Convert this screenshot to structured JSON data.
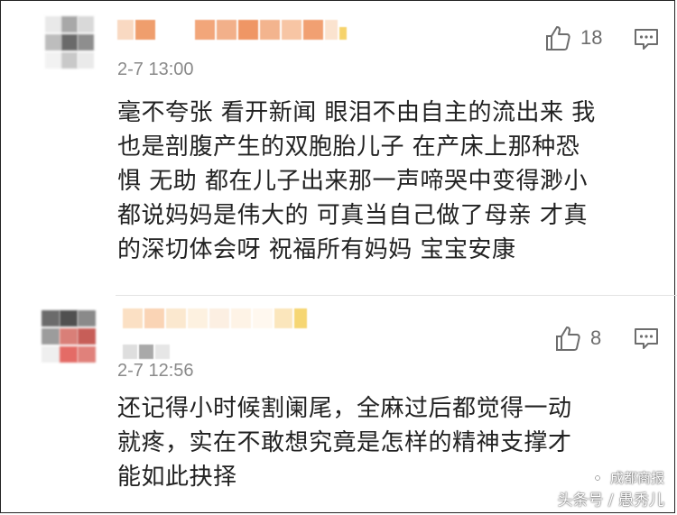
{
  "colors": {
    "text": "#222222",
    "meta": "#8a8a8a",
    "icon": "#6d6d6d",
    "divider": "#e3e3e3"
  },
  "comments": [
    {
      "time": "2-7 13:00",
      "likes": "18",
      "body_lines": [
        "毫不夸张 看开新闻 眼泪不由自主的流出来 我",
        "也是剖腹产生的双胞胎儿子 在产床上那种恐",
        "惧 无助 都在儿子出来那一声啼哭中变得渺小",
        "都说妈妈是伟大的 可真当自己做了母亲 才真",
        "的深切体会呀 祝福所有妈妈 宝宝安康"
      ]
    },
    {
      "time": "2-7 12:56",
      "likes": "8",
      "body_lines": [
        "还记得小时候割阑尾，全麻过后都觉得一动",
        "就疼，实在不敢想究竟是怎样的精神支撑才",
        "能如此抉择"
      ]
    }
  ],
  "watermark": {
    "line1": "成都商报",
    "line2": "头条号 / 愚秀儿"
  }
}
